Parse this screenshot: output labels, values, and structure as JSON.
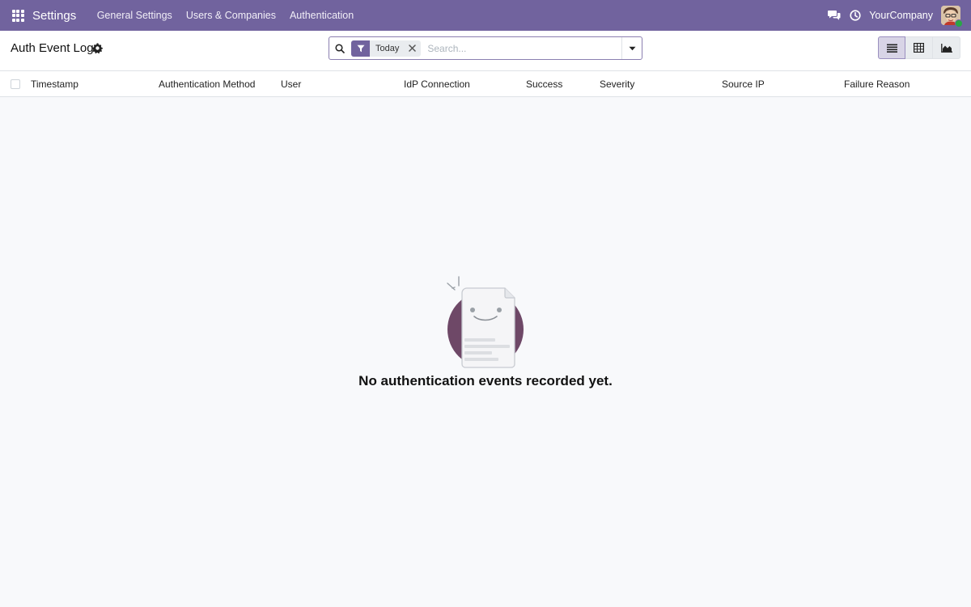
{
  "navbar": {
    "app_name": "Settings",
    "menu": [
      "General Settings",
      "Users & Companies",
      "Authentication"
    ],
    "company": "YourCompany",
    "icons": [
      "apps-grid-icon",
      "chat-icon",
      "clock-icon"
    ]
  },
  "control": {
    "title": "Auth Event Log",
    "search": {
      "facet_label": "Today",
      "placeholder": "Search..."
    },
    "views": [
      "list-view",
      "pivot-view",
      "graph-view"
    ],
    "active_view": "list-view"
  },
  "list": {
    "columns": [
      "Timestamp",
      "Authentication Method",
      "User",
      "IdP Connection",
      "Success",
      "Severity",
      "Source IP",
      "Failure Reason"
    ]
  },
  "empty_state": {
    "message": "No authentication events recorded yet."
  },
  "colors": {
    "brand": "#71639e",
    "background": "#f8f9fb",
    "illustration_circle": "#6e4867"
  }
}
